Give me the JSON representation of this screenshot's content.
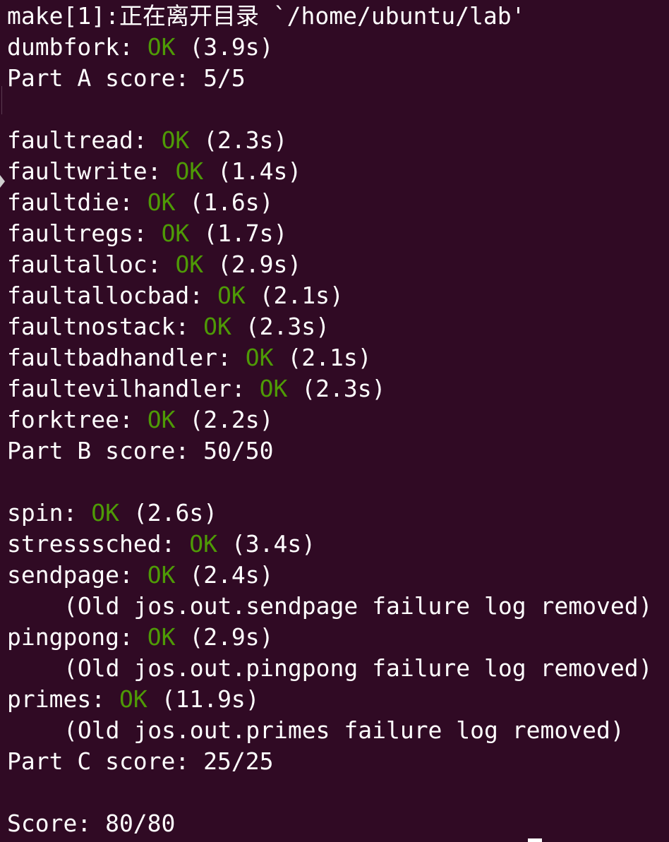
{
  "terminal": {
    "background": "#300a24",
    "foreground": "#ffffff",
    "ok_color": "#4e9a06",
    "lines": [
      {
        "kind": "plain",
        "text": "make[1]:正在离开目录 `/home/ubuntu/lab'"
      },
      {
        "kind": "test",
        "name": "dumbfork",
        "status": "OK",
        "time": "(3.9s)"
      },
      {
        "kind": "plain",
        "text": "Part A score: 5/5"
      },
      {
        "kind": "blank"
      },
      {
        "kind": "test",
        "name": "faultread",
        "status": "OK",
        "time": "(2.3s)"
      },
      {
        "kind": "test",
        "name": "faultwrite",
        "status": "OK",
        "time": "(1.4s)"
      },
      {
        "kind": "test",
        "name": "faultdie",
        "status": "OK",
        "time": "(1.6s)"
      },
      {
        "kind": "test",
        "name": "faultregs",
        "status": "OK",
        "time": "(1.7s)"
      },
      {
        "kind": "test",
        "name": "faultalloc",
        "status": "OK",
        "time": "(2.9s)"
      },
      {
        "kind": "test",
        "name": "faultallocbad",
        "status": "OK",
        "time": "(2.1s)"
      },
      {
        "kind": "test",
        "name": "faultnostack",
        "status": "OK",
        "time": "(2.3s)"
      },
      {
        "kind": "test",
        "name": "faultbadhandler",
        "status": "OK",
        "time": "(2.1s)"
      },
      {
        "kind": "test",
        "name": "faultevilhandler",
        "status": "OK",
        "time": "(2.3s)"
      },
      {
        "kind": "test",
        "name": "forktree",
        "status": "OK",
        "time": "(2.2s)"
      },
      {
        "kind": "plain",
        "text": "Part B score: 50/50"
      },
      {
        "kind": "blank"
      },
      {
        "kind": "test",
        "name": "spin",
        "status": "OK",
        "time": "(2.6s)"
      },
      {
        "kind": "test",
        "name": "stresssched",
        "status": "OK",
        "time": "(3.4s)"
      },
      {
        "kind": "test",
        "name": "sendpage",
        "status": "OK",
        "time": "(2.4s)"
      },
      {
        "kind": "note",
        "text": "(Old jos.out.sendpage failure log removed)"
      },
      {
        "kind": "test",
        "name": "pingpong",
        "status": "OK",
        "time": "(2.9s)"
      },
      {
        "kind": "note",
        "text": "(Old jos.out.pingpong failure log removed)"
      },
      {
        "kind": "test",
        "name": "primes",
        "status": "OK",
        "time": "(11.9s)"
      },
      {
        "kind": "note",
        "text": "(Old jos.out.primes failure log removed)"
      },
      {
        "kind": "plain",
        "text": "Part C score: 25/25"
      },
      {
        "kind": "blank"
      },
      {
        "kind": "plain",
        "text": "Score: 80/80"
      }
    ]
  }
}
